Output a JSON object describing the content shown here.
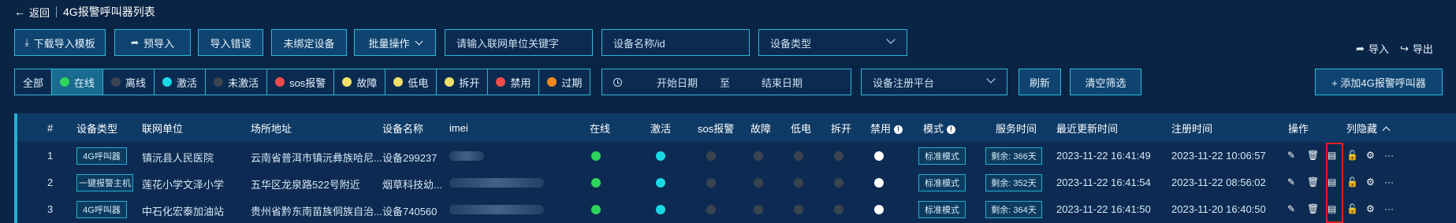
{
  "header": {
    "back_label": "返回",
    "title": "4G报警呼叫器列表"
  },
  "toolbar": {
    "download_template": "下载导入模板",
    "pre_import": "预导入",
    "import_error": "导入错误",
    "unbound_device": "未绑定设备",
    "batch_ops": "批量操作",
    "unit_placeholder": "请输入联网单位关键字",
    "device_placeholder": "设备名称/id",
    "device_type_placeholder": "设备类型",
    "import": "导入",
    "export": "导出"
  },
  "filters": {
    "items": [
      {
        "label": "全部",
        "dot": ""
      },
      {
        "label": "在线",
        "dot": "#2fd45a"
      },
      {
        "label": "离线",
        "dot": "#3a4350"
      },
      {
        "label": "激活",
        "dot": "#19d9e6"
      },
      {
        "label": "未激活",
        "dot": "#3a4350"
      },
      {
        "label": "sos报警",
        "dot": "#ef4b4b"
      },
      {
        "label": "故障",
        "dot": "#f1e06a"
      },
      {
        "label": "低电",
        "dot": "#f1e06a"
      },
      {
        "label": "拆开",
        "dot": "#f1e06a"
      },
      {
        "label": "禁用",
        "dot": "#ef4b4b"
      },
      {
        "label": "过期",
        "dot": "#f08a1f"
      }
    ],
    "start_date": "开始日期",
    "to": "至",
    "end_date": "结束日期",
    "platform_placeholder": "设备注册平台",
    "refresh": "刷新",
    "clear": "清空筛选",
    "add_button": "+ 添加4G报警呼叫器"
  },
  "table": {
    "headers": {
      "idx": "#",
      "type": "设备类型",
      "unit": "联网单位",
      "address": "场所地址",
      "name": "设备名称",
      "imei": "imei",
      "online": "在线",
      "active": "激活",
      "sos": "sos报警",
      "fault": "故障",
      "low": "低电",
      "open": "拆开",
      "disabled": "禁用",
      "mode": "模式",
      "service": "服务时间",
      "updated": "最近更新时间",
      "registered": "注册时间",
      "ops": "操作",
      "hide_cols": "列隐藏"
    },
    "rows": [
      {
        "idx": "1",
        "type": "4G呼叫器",
        "unit": "镇沅县人民医院",
        "address": "云南省普洱市镇沅彝族哈尼...",
        "name": "设备299237",
        "mode": "标准模式",
        "service": "剩余: 366天",
        "updated": "2023-11-22 16:41:49",
        "registered": "2023-11-22 10:06:57"
      },
      {
        "idx": "2",
        "type": "一键报警主机",
        "unit": "莲花小学文泽小学",
        "address": "五华区龙泉路522号附近",
        "name": "烟草科技幼...",
        "mode": "标准模式",
        "service": "剩余: 352天",
        "updated": "2023-11-22 16:41:54",
        "registered": "2023-11-22 08:56:02"
      },
      {
        "idx": "3",
        "type": "4G呼叫器",
        "unit": "中石化宏泰加油站",
        "address": "贵州省黔东南苗族侗族自治...",
        "name": "设备740560",
        "mode": "标准模式",
        "service": "剩余: 364天",
        "updated": "2023-11-22 16:41:50",
        "registered": "2023-11-20 16:40:50"
      }
    ]
  },
  "colors": {
    "online": "#2fd45a",
    "active": "#19d9e6",
    "off": "#3a4350",
    "white": "#ffffff",
    "accent": "#2bb9d9",
    "highlight": "#e02020"
  }
}
